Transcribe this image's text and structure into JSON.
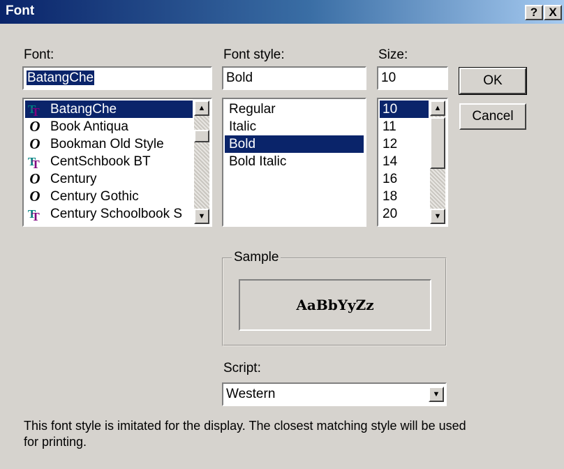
{
  "window": {
    "title": "Font",
    "help_label": "?",
    "close_label": "X"
  },
  "font": {
    "label": "Font:",
    "value": "BatangChe",
    "items": [
      {
        "name": "BatangChe",
        "icon": "truetype-icon",
        "selected": true
      },
      {
        "name": "Book Antiqua",
        "icon": "opentype-icon"
      },
      {
        "name": "Bookman Old Style",
        "icon": "opentype-icon"
      },
      {
        "name": "CentSchbook BT",
        "icon": "truetype-icon"
      },
      {
        "name": "Century",
        "icon": "opentype-icon"
      },
      {
        "name": "Century Gothic",
        "icon": "opentype-icon"
      },
      {
        "name": "Century Schoolbook S",
        "icon": "truetype-icon"
      }
    ]
  },
  "style": {
    "label": "Font style:",
    "value": "Bold",
    "items": [
      "Regular",
      "Italic",
      "Bold",
      "Bold Italic"
    ],
    "selected": "Bold"
  },
  "size": {
    "label": "Size:",
    "value": "10",
    "items": [
      "10",
      "11",
      "12",
      "14",
      "16",
      "18",
      "20"
    ],
    "selected": "10"
  },
  "buttons": {
    "ok": "OK",
    "cancel": "Cancel"
  },
  "sample": {
    "label": "Sample",
    "text": "AaBbYyZz"
  },
  "script": {
    "label": "Script:",
    "value": "Western"
  },
  "note": "This font style is imitated for the display. The closest matching style will be used for printing.",
  "colors": {
    "title_gradient_start": "#0a246a",
    "title_gradient_end": "#a6caf0",
    "face": "#d6d3ce",
    "selection": "#0a246a"
  }
}
